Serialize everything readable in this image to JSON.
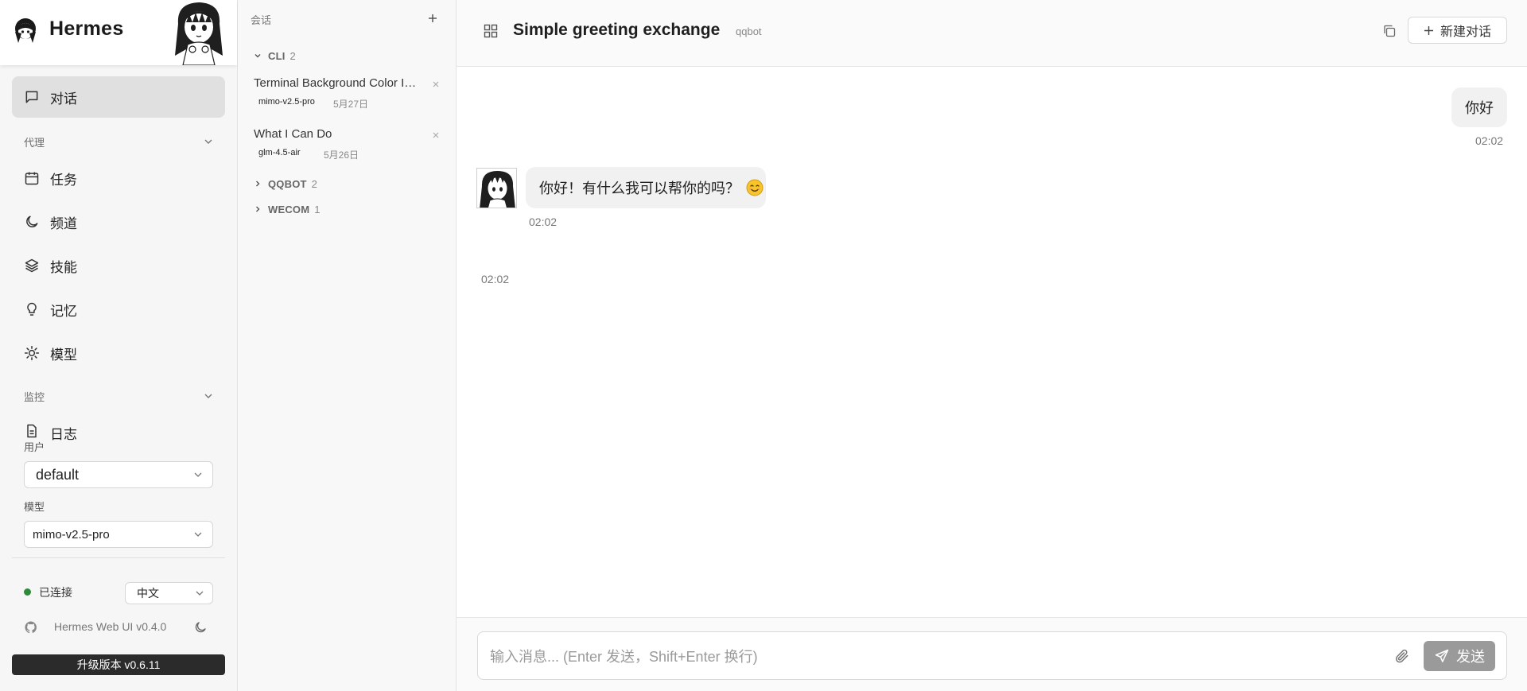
{
  "brand": {
    "name": "Hermes"
  },
  "sidebar": {
    "nav_chat": "对话",
    "section_agent": "代理",
    "nav_agent": [
      {
        "label": "任务",
        "icon": "calendar-icon"
      },
      {
        "label": "频道",
        "icon": "moon-icon"
      },
      {
        "label": "技能",
        "icon": "layers-icon"
      },
      {
        "label": "记忆",
        "icon": "lightbulb-icon"
      },
      {
        "label": "模型",
        "icon": "sun-icon"
      }
    ],
    "section_monitor": "监控",
    "nav_logs": "日志",
    "user_label": "用户",
    "user_value": "default",
    "model_label": "模型",
    "model_value": "mimo-v2.5-pro",
    "status": "已连接",
    "status_color": "#2e8b3b",
    "language": "中文",
    "version": "Hermes Web UI v0.4.0",
    "upgrade": "升级版本 v0.6.11"
  },
  "sessions": {
    "title": "会话",
    "groups": [
      {
        "name": "CLI",
        "count": "2",
        "expanded": true
      },
      {
        "name": "QQBOT",
        "count": "2",
        "expanded": false
      },
      {
        "name": "WECOM",
        "count": "1",
        "expanded": false
      }
    ],
    "items": [
      {
        "title": "Terminal Background Color Inquiry",
        "model": "mimo-v2.5-pro",
        "date": "5月27日"
      },
      {
        "title": "What I Can Do",
        "model": "glm-4.5-air",
        "date": "5月26日"
      }
    ]
  },
  "chat": {
    "title": "Simple greeting exchange",
    "tag": "qqbot",
    "new_chat": "新建对话",
    "messages": [
      {
        "role": "user",
        "text": "你好",
        "time": "02:02"
      },
      {
        "role": "assistant",
        "text": "你好！有什么我可以帮你的吗？",
        "emoji": "smiling-face-emoji",
        "time": "02:02"
      },
      {
        "role": "assistant",
        "text": "",
        "time": "02:02"
      }
    ]
  },
  "composer": {
    "placeholder": "输入消息... (Enter 发送，Shift+Enter 换行)",
    "value": "",
    "send": "发送"
  },
  "colors": {
    "accent_dark": "#2b2b2b",
    "send_disabled": "#9a9a9a",
    "active_nav": "#e0e0e0"
  }
}
